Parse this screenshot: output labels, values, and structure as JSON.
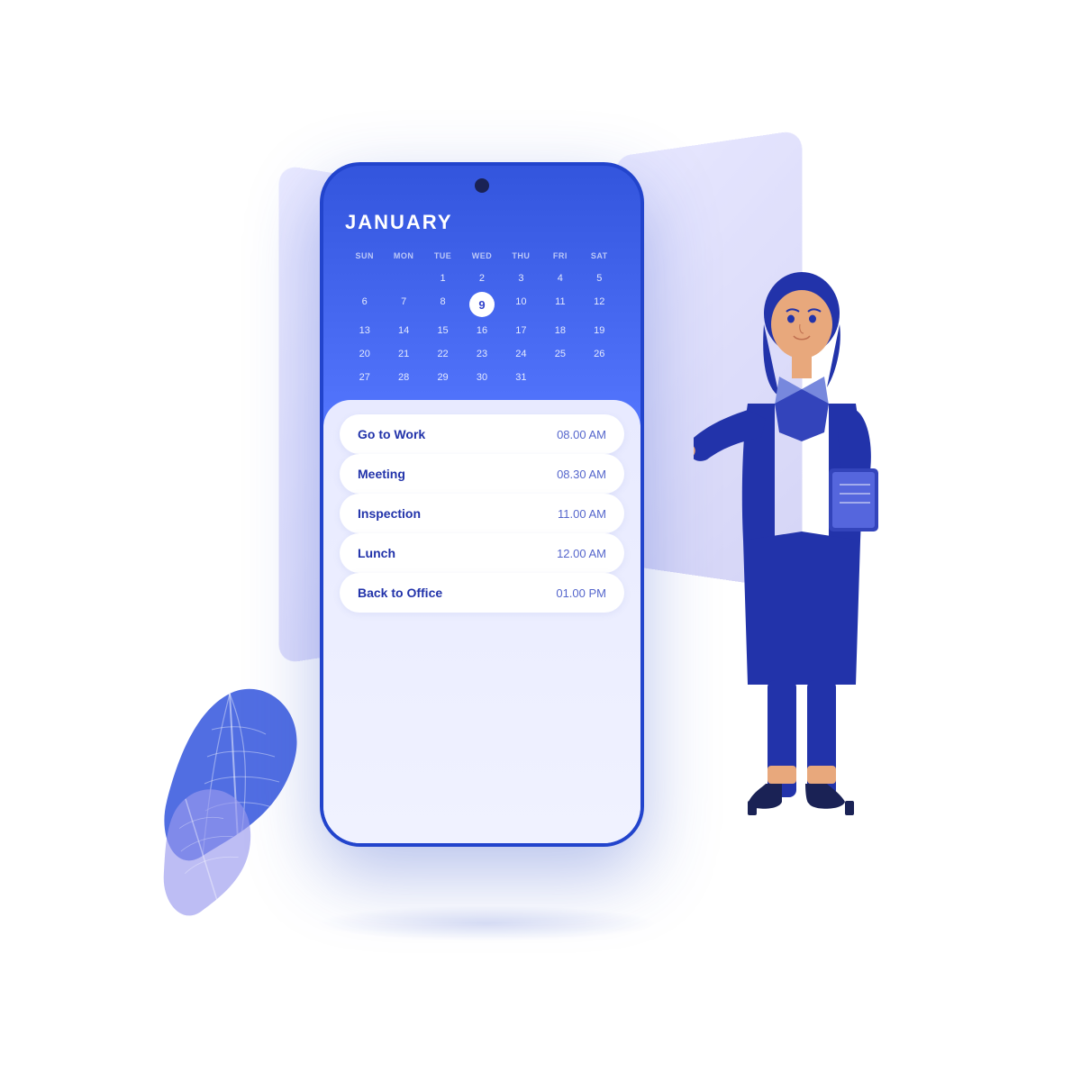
{
  "calendar": {
    "month": "JANUARY",
    "days_header": [
      "SUN",
      "MON",
      "TUE",
      "WED",
      "THU",
      "FRI",
      "SAT"
    ],
    "weeks": [
      [
        "",
        "",
        "1",
        "2",
        "3",
        "4",
        "5"
      ],
      [
        "6",
        "7",
        "8",
        "9",
        "10",
        "11",
        "12"
      ],
      [
        "13",
        "14",
        "15",
        "16",
        "17",
        "18",
        "19"
      ],
      [
        "20",
        "21",
        "22",
        "23",
        "24",
        "25",
        "26"
      ],
      [
        "27",
        "28",
        "29",
        "30",
        "31",
        "",
        ""
      ]
    ],
    "today": "9"
  },
  "schedule": {
    "items": [
      {
        "name": "Go to Work",
        "time": "08.00 AM"
      },
      {
        "name": "Meeting",
        "time": "08.30 AM"
      },
      {
        "name": "Inspection",
        "time": "11.00 AM"
      },
      {
        "name": "Lunch",
        "time": "12.00 AM"
      },
      {
        "name": "Back to Office",
        "time": "01.00 PM"
      }
    ]
  },
  "colors": {
    "phone_top": "#3355dd",
    "phone_bottom": "#f0f2ff",
    "accent": "#2233aa",
    "today_bg": "#ffffff",
    "today_text": "#3344cc"
  }
}
